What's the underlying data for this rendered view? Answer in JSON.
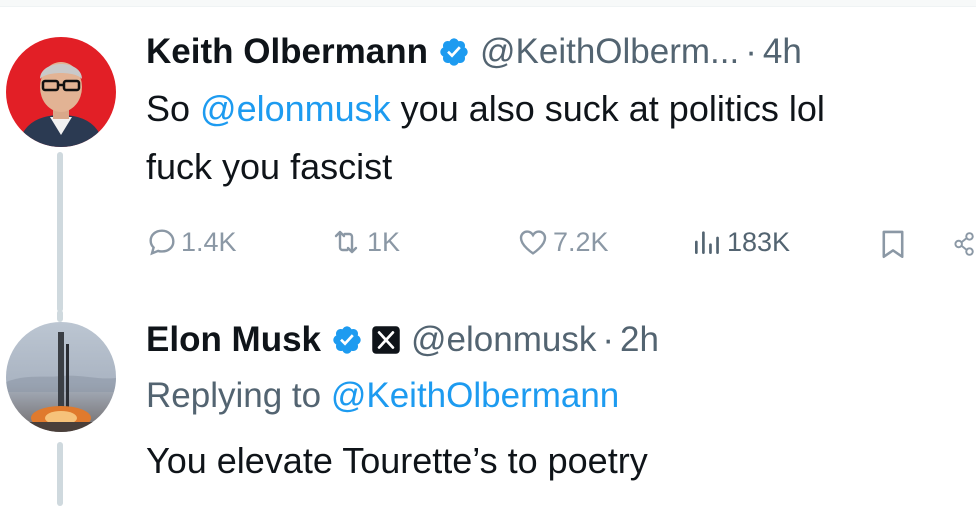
{
  "tweet1": {
    "name": "Keith Olbermann",
    "handle": "@KeithOlberm...",
    "separator": "·",
    "time": "4h",
    "text_pre": "So ",
    "mention": "@elonmusk",
    "text_post_line1": " you also suck at politics lol",
    "text_line2": "fuck you fascist",
    "avatar_icon": "person-portrait-avatar",
    "stats": {
      "replies": "1.4K",
      "reposts": "1K",
      "likes": "7.2K",
      "views": "183K"
    }
  },
  "tweet2": {
    "name": "Elon Musk",
    "handle": "@elonmusk",
    "separator": "·",
    "time": "2h",
    "replying_prefix": "Replying to ",
    "replying_handle": "@KeithOlbermann",
    "text": "You elevate Tourette’s to poetry",
    "avatar_icon": "rocket-launch-avatar"
  },
  "colors": {
    "accent": "#1d9bf0",
    "secondary_text": "#536471",
    "muted_icon": "#8b98a5",
    "thread_line": "#cfd9de"
  }
}
